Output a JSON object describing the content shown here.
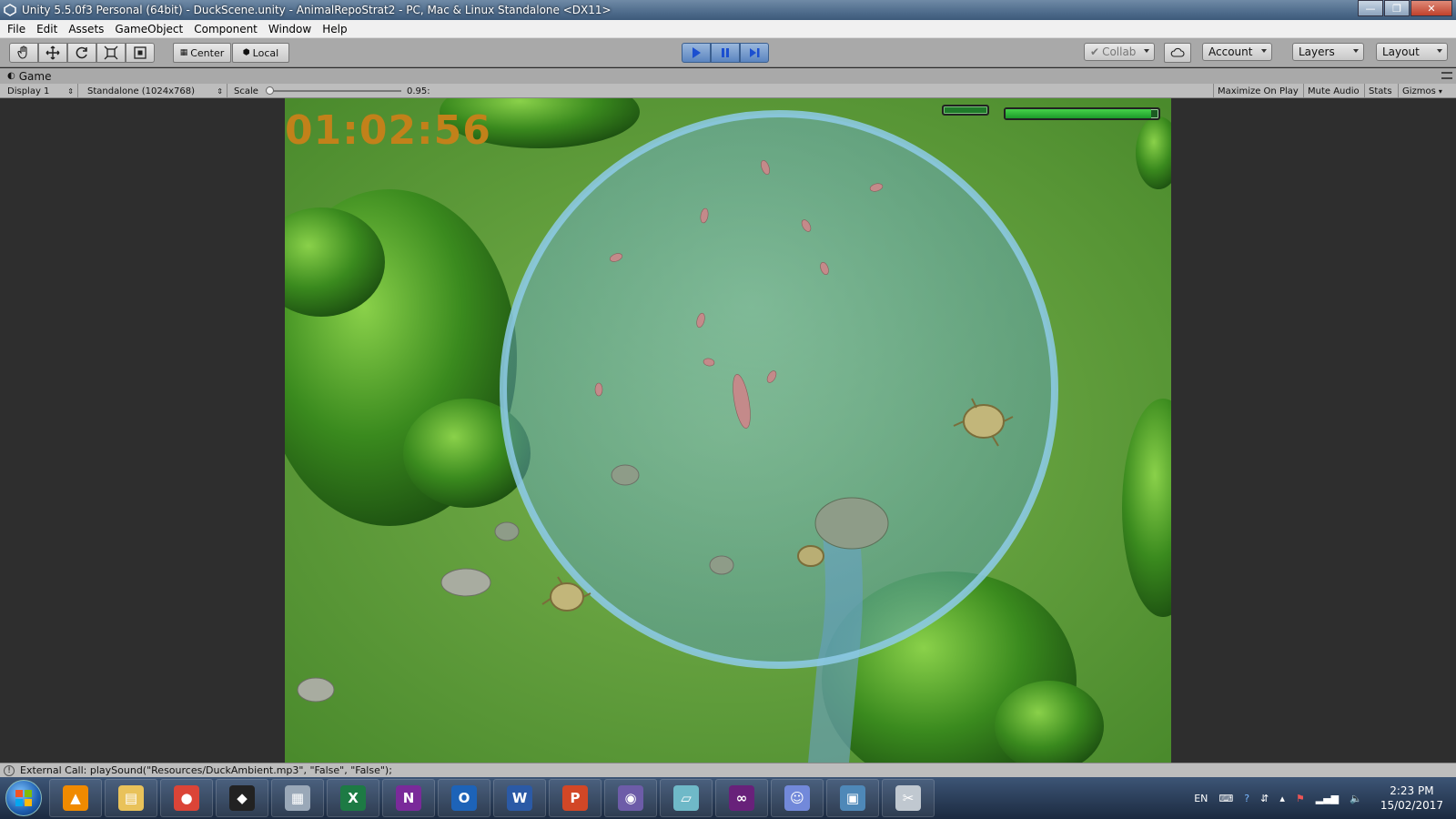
{
  "window": {
    "title": "Unity 5.5.0f3 Personal (64bit) - DuckScene.unity - AnimalRepoStrat2 - PC, Mac & Linux Standalone <DX11>",
    "minimize_glyph": "—",
    "restore_glyph": "❐",
    "close_glyph": "✕"
  },
  "menu": {
    "items": [
      "File",
      "Edit",
      "Assets",
      "GameObject",
      "Component",
      "Window",
      "Help"
    ]
  },
  "toolbar": {
    "pivot_label": "Center",
    "space_label": "Local",
    "collab_label": "Collab",
    "account_label": "Account",
    "layers_label": "Layers",
    "layout_label": "Layout",
    "play_state": "playing"
  },
  "game_tab": {
    "label": "Game",
    "display_label": "Display 1",
    "resolution_label": "Standalone (1024x768)",
    "scale_label": "Scale",
    "scale_value": "0.95:",
    "scale_fraction": 0.02,
    "maximize_label": "Maximize On Play",
    "mute_label": "Mute Audio",
    "stats_label": "Stats",
    "gizmos_label": "Gizmos"
  },
  "game": {
    "timer": "01:02:56",
    "health_fraction": 0.95,
    "colors": {
      "timer": "#c2811a",
      "grass": "#5c9b38",
      "water_circle": "#6fb2d6",
      "hud_bar": "#2fbf3a"
    }
  },
  "status": {
    "message": "External Call: playSound(\"Resources/DuckAmbient.mp3\", \"False\", \"False\");"
  },
  "taskbar": {
    "apps": [
      {
        "name": "vlc",
        "glyph": "▲",
        "color": "#f08a00"
      },
      {
        "name": "file-explorer",
        "glyph": "▤",
        "color": "#e9c25a"
      },
      {
        "name": "chrome",
        "glyph": "●",
        "color": "#db4437"
      },
      {
        "name": "unity",
        "glyph": "◆",
        "color": "#222222"
      },
      {
        "name": "calculator",
        "glyph": "▦",
        "color": "#9aa8b8"
      },
      {
        "name": "excel",
        "glyph": "X",
        "color": "#1d7a44"
      },
      {
        "name": "onenote",
        "glyph": "N",
        "color": "#7a2a9a"
      },
      {
        "name": "outlook",
        "glyph": "O",
        "color": "#1d63b8"
      },
      {
        "name": "word",
        "glyph": "W",
        "color": "#2b5aa6"
      },
      {
        "name": "powerpoint",
        "glyph": "P",
        "color": "#d24726"
      },
      {
        "name": "github-desktop",
        "glyph": "◉",
        "color": "#6d5ca8"
      },
      {
        "name": "notepad",
        "glyph": "▱",
        "color": "#6fb9c8"
      },
      {
        "name": "visual-studio",
        "glyph": "∞",
        "color": "#68217a"
      },
      {
        "name": "discord",
        "glyph": "☺",
        "color": "#7289da"
      },
      {
        "name": "photos",
        "glyph": "▣",
        "color": "#4e88b8"
      },
      {
        "name": "snipping-tool",
        "glyph": "✂",
        "color": "#c0c8d0"
      }
    ],
    "language": "EN",
    "time": "2:23 PM",
    "date": "15/02/2017"
  }
}
